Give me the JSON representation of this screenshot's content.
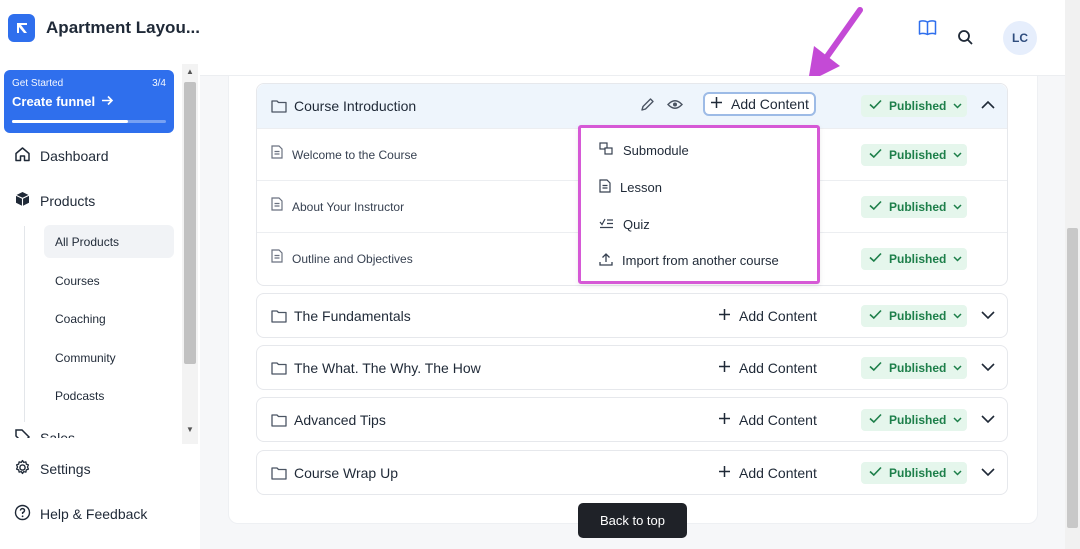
{
  "app": {
    "title": "Apartment Layou..."
  },
  "funnel": {
    "label": "Get Started",
    "progress_text": "3/4",
    "cta": "Create funnel",
    "progress": 0.75,
    "color": "#2f6fed"
  },
  "nav": {
    "dashboard": "Dashboard",
    "products": "Products",
    "sub_items": [
      "All Products",
      "Courses",
      "Coaching",
      "Community",
      "Podcasts"
    ],
    "sales": "Sales",
    "settings": "Settings",
    "help": "Help & Feedback"
  },
  "topbar": {
    "avatar_initials": "LC"
  },
  "modules": [
    {
      "title": "Course Introduction",
      "add_label": "Add Content",
      "status": "Published",
      "lessons": [
        {
          "title": "Welcome to the Course",
          "status": "Published"
        },
        {
          "title": "About Your Instructor",
          "status": "Published"
        },
        {
          "title": "Outline and Objectives",
          "status": "Published"
        }
      ]
    },
    {
      "title": "The Fundamentals",
      "add_label": "Add Content",
      "status": "Published"
    },
    {
      "title": "The What. The Why. The How",
      "add_label": "Add Content",
      "status": "Published"
    },
    {
      "title": "Advanced Tips",
      "add_label": "Add Content",
      "status": "Published"
    },
    {
      "title": "Course Wrap Up",
      "add_label": "Add Content",
      "status": "Published"
    }
  ],
  "dropdown": {
    "items": [
      "Submodule",
      "Lesson",
      "Quiz",
      "Import from another course"
    ],
    "highlight_color": "#d659d6"
  },
  "back_to_top": "Back to top",
  "colors": {
    "published_bg": "#e5f6ec",
    "published_text": "#1d7f4a",
    "annotation": "#c44ad6"
  }
}
